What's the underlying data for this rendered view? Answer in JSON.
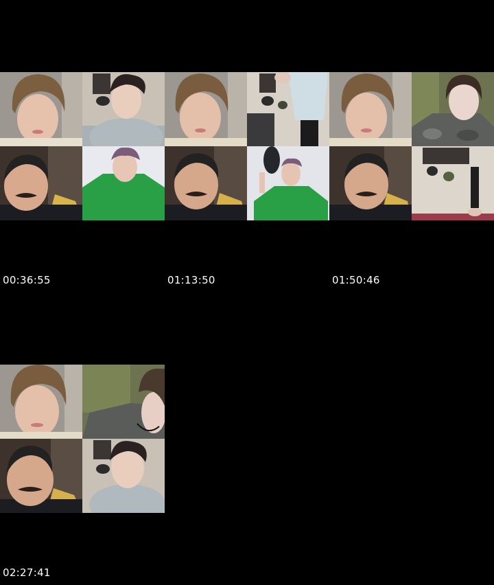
{
  "sheet": {
    "timestamps": [
      {
        "label": "00:36:55"
      },
      {
        "label": "01:13:50"
      },
      {
        "label": "01:50:46"
      },
      {
        "label": "02:27:41"
      }
    ],
    "colors": {
      "background": "#000000",
      "text": "#ffffff"
    }
  }
}
